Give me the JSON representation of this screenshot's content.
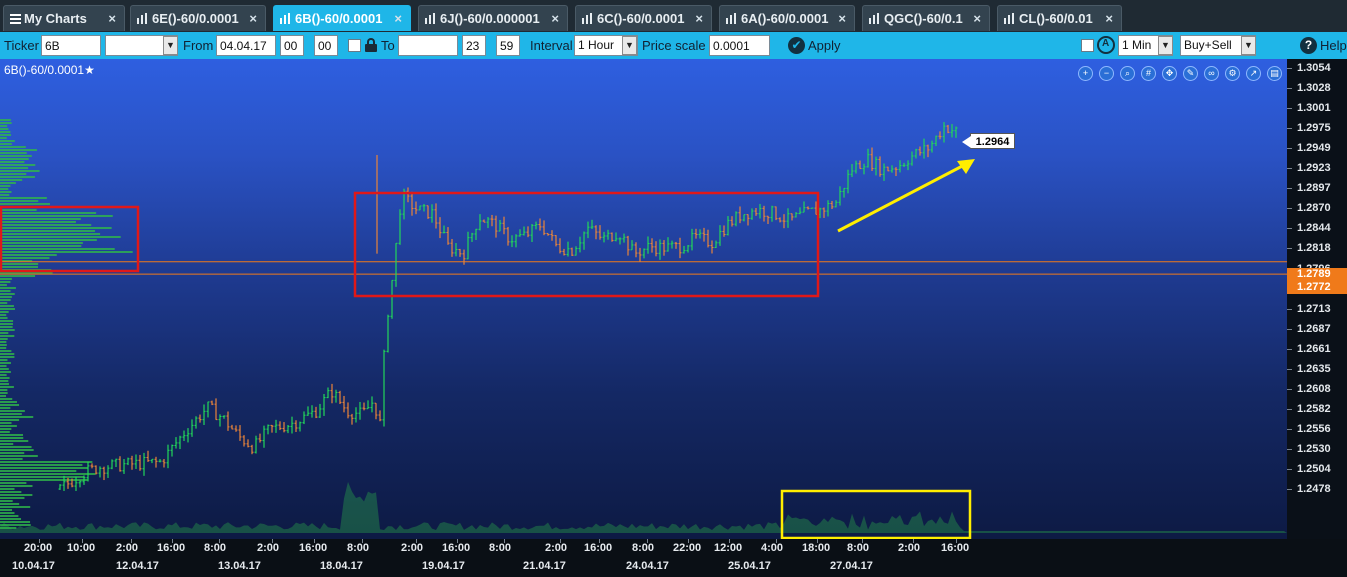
{
  "tabs": [
    {
      "label": "My Charts",
      "icon": "menu-icon",
      "active": false
    },
    {
      "label": "6E()-60/0.0001",
      "icon": "bar-chart-icon",
      "active": false
    },
    {
      "label": "6B()-60/0.0001",
      "icon": "bar-chart-icon",
      "active": true
    },
    {
      "label": "6J()-60/0.000001",
      "icon": "bar-chart-icon",
      "active": false
    },
    {
      "label": "6C()-60/0.0001",
      "icon": "bar-chart-icon",
      "active": false
    },
    {
      "label": "6A()-60/0.0001",
      "icon": "bar-chart-icon",
      "active": false
    },
    {
      "label": "QGC()-60/0.1",
      "icon": "bar-chart-icon",
      "active": false
    },
    {
      "label": "CL()-60/0.01",
      "icon": "bar-chart-icon",
      "active": false
    }
  ],
  "close_glyph": "×",
  "toolbar": {
    "ticker_label": "Ticker",
    "ticker_value": "6B",
    "ticker_select_value": "",
    "from_label": "From",
    "from_date": "04.04.17",
    "from_hour": "00",
    "from_min": "00",
    "to_label": "To",
    "to_date": "",
    "to_hour": "23",
    "to_min": "59",
    "interval_label": "Interval",
    "interval_value": "1 Hour",
    "price_scale_label": "Price scale",
    "price_scale_value": "0.0001",
    "apply_label": "Apply",
    "period_value": "1 Min",
    "side_value": "Buy+Sell",
    "help_label": "Help"
  },
  "chart": {
    "title": "6B()-60/0.0001",
    "title_star": "★",
    "last_price": "1.2964",
    "price_ticks": [
      "1.3054",
      "1.3028",
      "1.3001",
      "1.2975",
      "1.2949",
      "1.2923",
      "1.2897",
      "1.2870",
      "1.2844",
      "1.2818",
      "1.2796",
      "1.2739",
      "1.2713",
      "1.2687",
      "1.2661",
      "1.2635",
      "1.2608",
      "1.2582",
      "1.2556",
      "1.2530",
      "1.2504",
      "1.2478"
    ],
    "highlight_prices": [
      "1.2789",
      "1.2772"
    ],
    "time_ticks": [
      "20:00",
      "10:00",
      "2:00",
      "16:00",
      "8:00",
      "2:00",
      "16:00",
      "8:00",
      "2:00",
      "16:00",
      "8:00",
      "2:00",
      "16:00",
      "8:00",
      "22:00",
      "12:00",
      "4:00",
      "18:00",
      "8:00",
      "2:00",
      "16:00"
    ],
    "date_ticks": [
      "10.04.17",
      "12.04.17",
      "13.04.17",
      "18.04.17",
      "19.04.17",
      "21.04.17",
      "24.04.17",
      "25.04.17",
      "27.04.17"
    ],
    "colors": {
      "up": "#22d65a",
      "down": "#e8843a",
      "level_line": "#f07a1a",
      "red_box": "#e01818",
      "yellow": "#ffee00",
      "profile": "#2fb84a"
    }
  },
  "chart_data": {
    "type": "candlestick",
    "title": "6B()-60/0.0001",
    "ylim": [
      1.246,
      1.3066
    ],
    "levels": [
      1.2789,
      1.2772
    ],
    "last": 1.2964,
    "path": [
      [
        0.0,
        1.2478
      ],
      [
        0.03,
        1.25
      ],
      [
        0.05,
        1.2508
      ],
      [
        0.09,
        1.2512
      ],
      [
        0.13,
        1.2515
      ],
      [
        0.16,
        1.2555
      ],
      [
        0.19,
        1.259
      ],
      [
        0.21,
        1.2575
      ],
      [
        0.23,
        1.255
      ],
      [
        0.25,
        1.2535
      ],
      [
        0.27,
        1.256
      ],
      [
        0.3,
        1.2568
      ],
      [
        0.33,
        1.2585
      ],
      [
        0.35,
        1.2612
      ],
      [
        0.37,
        1.2585
      ],
      [
        0.39,
        1.258
      ],
      [
        0.405,
        1.26
      ],
      [
        0.412,
        1.256
      ],
      [
        0.42,
        1.27
      ],
      [
        0.43,
        1.278
      ],
      [
        0.44,
        1.288
      ],
      [
        0.46,
        1.286
      ],
      [
        0.48,
        1.2855
      ],
      [
        0.5,
        1.281
      ],
      [
        0.52,
        1.28
      ],
      [
        0.54,
        1.285
      ],
      [
        0.56,
        1.284
      ],
      [
        0.58,
        1.282
      ],
      [
        0.6,
        1.2825
      ],
      [
        0.62,
        1.284
      ],
      [
        0.64,
        1.281
      ],
      [
        0.66,
        1.2805
      ],
      [
        0.68,
        1.2835
      ],
      [
        0.7,
        1.282
      ],
      [
        0.72,
        1.283
      ],
      [
        0.74,
        1.28
      ],
      [
        0.76,
        1.281
      ],
      [
        0.78,
        1.2808
      ],
      [
        0.8,
        1.281
      ],
      [
        0.82,
        1.2822
      ],
      [
        0.84,
        1.2815
      ],
      [
        0.86,
        1.284
      ],
      [
        0.88,
        1.2855
      ],
      [
        0.9,
        1.286
      ],
      [
        0.92,
        1.2855
      ],
      [
        0.94,
        1.2845
      ],
      [
        0.96,
        1.2855
      ],
      [
        0.98,
        1.286
      ],
      [
        1.0,
        1.287
      ],
      [
        1.02,
        1.2915
      ],
      [
        1.04,
        1.293
      ],
      [
        1.06,
        1.2915
      ],
      [
        1.08,
        1.292
      ],
      [
        1.1,
        1.2935
      ],
      [
        1.12,
        1.2945
      ],
      [
        1.14,
        1.2975
      ],
      [
        1.16,
        1.2964
      ]
    ]
  }
}
